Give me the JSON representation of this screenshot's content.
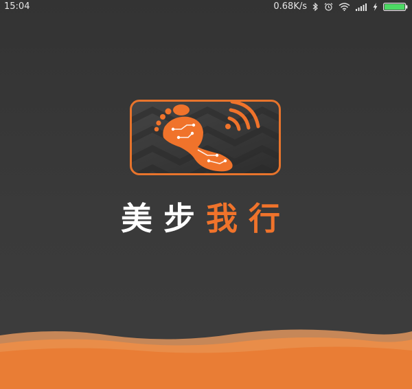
{
  "status_bar": {
    "time": "15:04",
    "network_speed": "0.68K/s",
    "icons": [
      "bluetooth-icon",
      "alarm-icon",
      "wifi-icon",
      "signal-icon",
      "charging-icon",
      "battery-icon"
    ],
    "battery_color": "#4cd964"
  },
  "splash": {
    "app_name_part1": "美步",
    "app_name_part2": "我行",
    "logo_icon": "footprint-signal-icon"
  },
  "colors": {
    "accent": "#f0732b",
    "background": "#3a3a3a",
    "wave_light": "#f4a062",
    "wave_dark": "#e97d35"
  }
}
